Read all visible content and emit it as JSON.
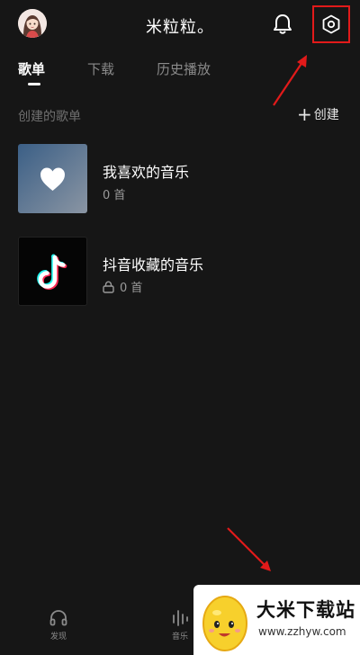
{
  "header": {
    "title": "米粒粒。",
    "avatar_icon": "avatar",
    "bell_icon": "bell-icon",
    "settings_icon": "gear-icon"
  },
  "tabs": [
    {
      "label": "歌单",
      "active": true
    },
    {
      "label": "下载",
      "active": false
    },
    {
      "label": "历史播放",
      "active": false
    }
  ],
  "section": {
    "title": "创建的歌单",
    "create_label": "创建"
  },
  "playlists": [
    {
      "name": "我喜欢的音乐",
      "count": "0 首",
      "icon": "heart-icon",
      "locked": false
    },
    {
      "name": "抖音收藏的音乐",
      "count": "0 首",
      "icon": "tiktok-icon",
      "locked": true
    }
  ],
  "bottom_nav": [
    {
      "label": "发现",
      "icon": "headphones-icon"
    },
    {
      "label": "音乐",
      "icon": "equalizer-icon"
    }
  ],
  "watermark": {
    "title": "大米下载站",
    "url": "www.zzhyw.com"
  },
  "colors": {
    "background": "#161616",
    "highlight_box": "#e21a1a",
    "arrow": "#e21a1a"
  }
}
